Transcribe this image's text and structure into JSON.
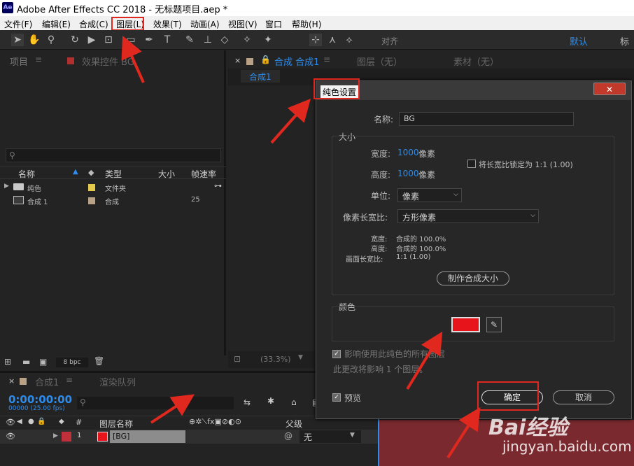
{
  "window": {
    "app_badge": "Ae",
    "title": "Adobe After Effects CC 2018 - 无标题项目.aep *"
  },
  "menu": [
    "文件(F)",
    "编辑(E)",
    "合成(C)",
    "图层(L)",
    "效果(T)",
    "动画(A)",
    "视图(V)",
    "窗口",
    "帮助(H)"
  ],
  "toolbar": {
    "align_label": "对齐",
    "workspace": "默认",
    "workspace2": "标准"
  },
  "project": {
    "tab": "项目",
    "tab2": "效果控件 BG",
    "search_placeholder": "",
    "columns": [
      "名称",
      "类型",
      "大小",
      "帧速率"
    ],
    "rows": [
      {
        "name": "纯色",
        "type": "文件夹",
        "rate": ""
      },
      {
        "name": "合成 1",
        "type": "合成",
        "rate": "25"
      }
    ],
    "bpc": "8 bpc"
  },
  "viewer": {
    "tab": "合成 合成1",
    "layer_tab": "图层（无）",
    "footage_tab": "素材（无）",
    "subtab": "合成1",
    "zoom": "(33.3%)"
  },
  "dialog": {
    "title": "纯色设置",
    "name_label": "名称:",
    "name_value": "BG",
    "size_title": "大小",
    "width_label": "宽度:",
    "width_value": "1000",
    "height_label": "高度:",
    "height_value": "1000",
    "px": "像素",
    "lock_label": "将长宽比锁定为 1:1 (1.00)",
    "unit_label": "单位:",
    "unit_value": "像素",
    "pixel_aspect_label": "像素长宽比:",
    "pixel_aspect_value": "方形像素",
    "info_w_label": "宽度:",
    "info_w": "合成的 100.0%",
    "info_h_label": "高度:",
    "info_h": "合成的 100.0%",
    "frame_aspect_label": "画面长宽比:",
    "frame_aspect": "1:1 (1.00)",
    "make_comp_size": "制作合成大小",
    "color_title": "颜色",
    "color_value": "#e8141c",
    "affect_label": "影响使用此纯色的所有图层",
    "change_note": "此更改将影响 1 个图层。",
    "preview_label": "预览",
    "ok": "确定",
    "cancel": "取消"
  },
  "timeline": {
    "tab": "合成1",
    "render_tab": "渲染队列",
    "timecode": "0:00:00:00",
    "fps": "00000 (25.00 fps)",
    "layer_name_header": "图层名称",
    "parent_header": "父级",
    "hash_header": "#",
    "layer": {
      "index": "1",
      "name": "[BG]",
      "parent": "无"
    }
  },
  "watermark": {
    "brand": "Bai经验",
    "url": "jingyan.baidu.com"
  }
}
